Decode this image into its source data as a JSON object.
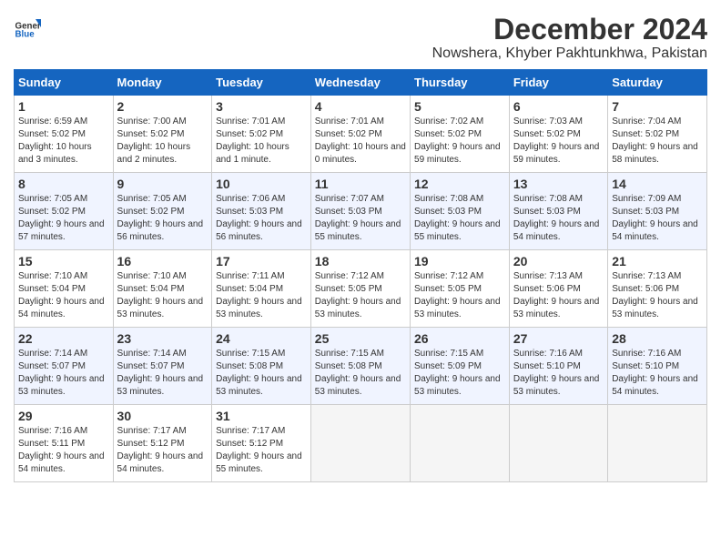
{
  "logo": {
    "general": "General",
    "blue": "Blue"
  },
  "title": "December 2024",
  "subtitle": "Nowshera, Khyber Pakhtunkhwa, Pakistan",
  "days_of_week": [
    "Sunday",
    "Monday",
    "Tuesday",
    "Wednesday",
    "Thursday",
    "Friday",
    "Saturday"
  ],
  "weeks": [
    [
      {
        "day": "1",
        "sunrise": "6:59 AM",
        "sunset": "5:02 PM",
        "daylight": "10 hours and 3 minutes."
      },
      {
        "day": "2",
        "sunrise": "7:00 AM",
        "sunset": "5:02 PM",
        "daylight": "10 hours and 2 minutes."
      },
      {
        "day": "3",
        "sunrise": "7:01 AM",
        "sunset": "5:02 PM",
        "daylight": "10 hours and 1 minute."
      },
      {
        "day": "4",
        "sunrise": "7:01 AM",
        "sunset": "5:02 PM",
        "daylight": "10 hours and 0 minutes."
      },
      {
        "day": "5",
        "sunrise": "7:02 AM",
        "sunset": "5:02 PM",
        "daylight": "9 hours and 59 minutes."
      },
      {
        "day": "6",
        "sunrise": "7:03 AM",
        "sunset": "5:02 PM",
        "daylight": "9 hours and 59 minutes."
      },
      {
        "day": "7",
        "sunrise": "7:04 AM",
        "sunset": "5:02 PM",
        "daylight": "9 hours and 58 minutes."
      }
    ],
    [
      {
        "day": "8",
        "sunrise": "7:05 AM",
        "sunset": "5:02 PM",
        "daylight": "9 hours and 57 minutes."
      },
      {
        "day": "9",
        "sunrise": "7:05 AM",
        "sunset": "5:02 PM",
        "daylight": "9 hours and 56 minutes."
      },
      {
        "day": "10",
        "sunrise": "7:06 AM",
        "sunset": "5:03 PM",
        "daylight": "9 hours and 56 minutes."
      },
      {
        "day": "11",
        "sunrise": "7:07 AM",
        "sunset": "5:03 PM",
        "daylight": "9 hours and 55 minutes."
      },
      {
        "day": "12",
        "sunrise": "7:08 AM",
        "sunset": "5:03 PM",
        "daylight": "9 hours and 55 minutes."
      },
      {
        "day": "13",
        "sunrise": "7:08 AM",
        "sunset": "5:03 PM",
        "daylight": "9 hours and 54 minutes."
      },
      {
        "day": "14",
        "sunrise": "7:09 AM",
        "sunset": "5:03 PM",
        "daylight": "9 hours and 54 minutes."
      }
    ],
    [
      {
        "day": "15",
        "sunrise": "7:10 AM",
        "sunset": "5:04 PM",
        "daylight": "9 hours and 54 minutes."
      },
      {
        "day": "16",
        "sunrise": "7:10 AM",
        "sunset": "5:04 PM",
        "daylight": "9 hours and 53 minutes."
      },
      {
        "day": "17",
        "sunrise": "7:11 AM",
        "sunset": "5:04 PM",
        "daylight": "9 hours and 53 minutes."
      },
      {
        "day": "18",
        "sunrise": "7:12 AM",
        "sunset": "5:05 PM",
        "daylight": "9 hours and 53 minutes."
      },
      {
        "day": "19",
        "sunrise": "7:12 AM",
        "sunset": "5:05 PM",
        "daylight": "9 hours and 53 minutes."
      },
      {
        "day": "20",
        "sunrise": "7:13 AM",
        "sunset": "5:06 PM",
        "daylight": "9 hours and 53 minutes."
      },
      {
        "day": "21",
        "sunrise": "7:13 AM",
        "sunset": "5:06 PM",
        "daylight": "9 hours and 53 minutes."
      }
    ],
    [
      {
        "day": "22",
        "sunrise": "7:14 AM",
        "sunset": "5:07 PM",
        "daylight": "9 hours and 53 minutes."
      },
      {
        "day": "23",
        "sunrise": "7:14 AM",
        "sunset": "5:07 PM",
        "daylight": "9 hours and 53 minutes."
      },
      {
        "day": "24",
        "sunrise": "7:15 AM",
        "sunset": "5:08 PM",
        "daylight": "9 hours and 53 minutes."
      },
      {
        "day": "25",
        "sunrise": "7:15 AM",
        "sunset": "5:08 PM",
        "daylight": "9 hours and 53 minutes."
      },
      {
        "day": "26",
        "sunrise": "7:15 AM",
        "sunset": "5:09 PM",
        "daylight": "9 hours and 53 minutes."
      },
      {
        "day": "27",
        "sunrise": "7:16 AM",
        "sunset": "5:10 PM",
        "daylight": "9 hours and 53 minutes."
      },
      {
        "day": "28",
        "sunrise": "7:16 AM",
        "sunset": "5:10 PM",
        "daylight": "9 hours and 54 minutes."
      }
    ],
    [
      {
        "day": "29",
        "sunrise": "7:16 AM",
        "sunset": "5:11 PM",
        "daylight": "9 hours and 54 minutes."
      },
      {
        "day": "30",
        "sunrise": "7:17 AM",
        "sunset": "5:12 PM",
        "daylight": "9 hours and 54 minutes."
      },
      {
        "day": "31",
        "sunrise": "7:17 AM",
        "sunset": "5:12 PM",
        "daylight": "9 hours and 55 minutes."
      },
      null,
      null,
      null,
      null
    ]
  ],
  "labels": {
    "sunrise": "Sunrise:",
    "sunset": "Sunset:",
    "daylight": "Daylight:"
  }
}
